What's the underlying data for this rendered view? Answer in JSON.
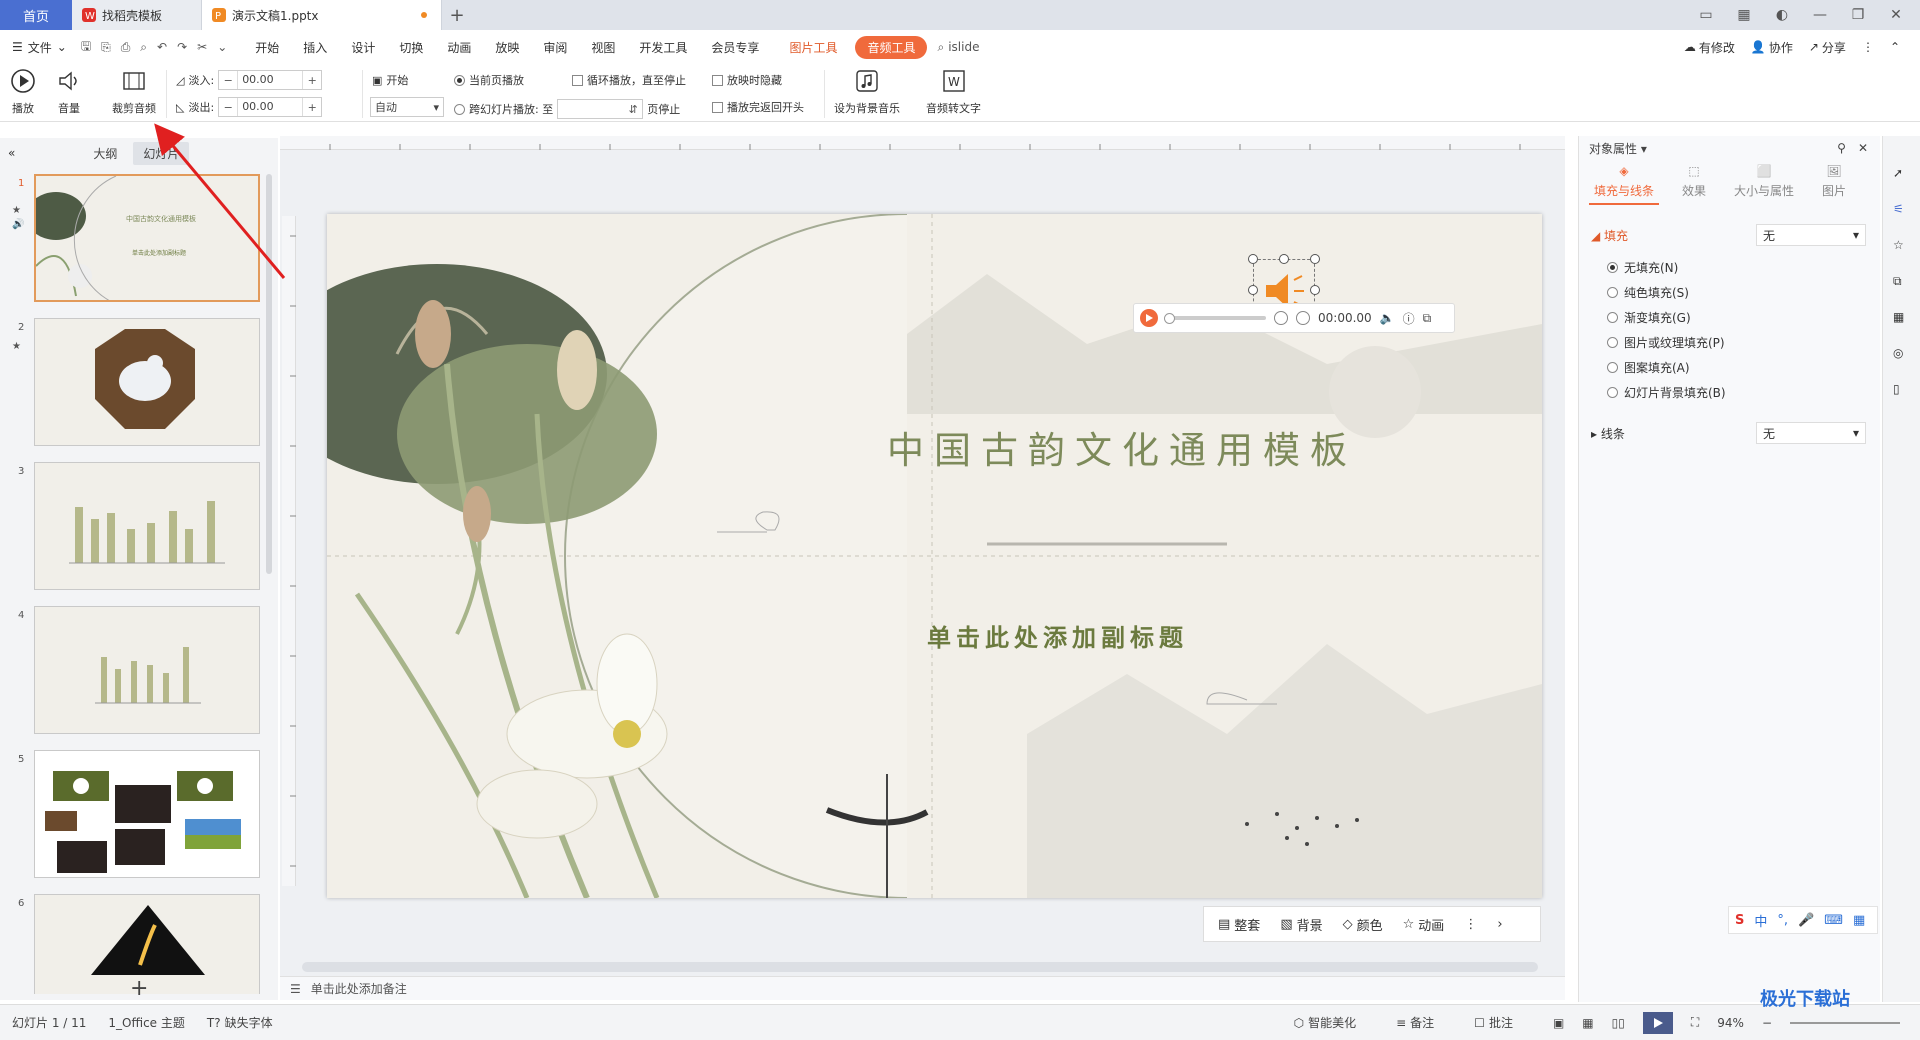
{
  "tabs": {
    "home": "首页",
    "tab1": "找稻壳模板",
    "tab2": "演示文稿1.pptx"
  },
  "menu": {
    "file": "文件",
    "items": [
      "开始",
      "插入",
      "设计",
      "切换",
      "动画",
      "放映",
      "审阅",
      "视图",
      "开发工具",
      "会员专享"
    ],
    "picture_tool": "图片工具",
    "audio_tool": "音频工具",
    "islide": "islide",
    "modified": "有修改",
    "collab": "协作",
    "share": "分享"
  },
  "ribbon": {
    "play": "播放",
    "volume": "音量",
    "trim": "裁剪音频",
    "fade_in_label": "淡入:",
    "fade_in_value": "00.00",
    "fade_out_label": "淡出:",
    "fade_out_value": "00.00",
    "start_label": "开始",
    "start_value": "自动",
    "current_page": "当前页播放",
    "cross_slide": "跨幻灯片播放: 至",
    "page_stop": "页停止",
    "loop": "循环播放，直至停止",
    "hide": "放映时隐藏",
    "rewind": "播放完返回开头",
    "bg_music": "设为背景音乐",
    "to_text": "音频转文字"
  },
  "left_panel": {
    "outline": "大纲",
    "slides": "幻灯片",
    "numbers": [
      "1",
      "2",
      "3",
      "4",
      "5",
      "6"
    ]
  },
  "slide": {
    "title": "中国古韵文化通用模板",
    "subtitle": "单击此处添加副标题",
    "audio_time": "00:00.00",
    "thumb1_title": "中国古韵文化通用模板",
    "thumb1_sub": "单击此处添加副标题"
  },
  "slidebar": {
    "whole": "整套",
    "bg": "背景",
    "color": "颜色",
    "anim": "动画"
  },
  "notes": "单击此处添加备注",
  "right_panel": {
    "title": "对象属性",
    "tabs": [
      "填充与线条",
      "效果",
      "大小与属性",
      "图片"
    ],
    "fill_label": "填充",
    "fill_value": "无",
    "options": [
      "无填充(N)",
      "纯色填充(S)",
      "渐变填充(G)",
      "图片或纹理填充(P)",
      "图案填充(A)",
      "幻灯片背景填充(B)"
    ],
    "line_label": "线条",
    "line_value": "无"
  },
  "status": {
    "slide_info": "幻灯片 1 / 11",
    "theme": "1_Office 主题",
    "font_missing": "缺失字体",
    "smart": "智能美化",
    "notes": "备注",
    "comment": "批注",
    "zoom": "94%"
  },
  "ime": {
    "cn": "中"
  },
  "watermark": "极光下载站",
  "colors": {
    "accent": "#f06a3c",
    "tab_home": "#4a6fd1",
    "title": "#7d8a5a"
  }
}
